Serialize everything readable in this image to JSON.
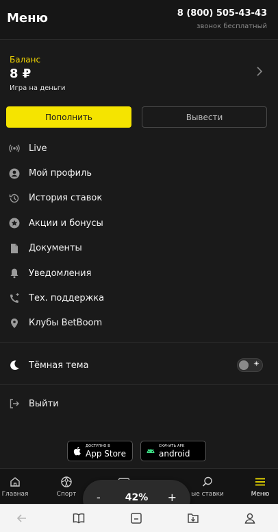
{
  "header": {
    "title": "Меню",
    "phone": "8 (800) 505-43-43",
    "phone_note": "звонок бесплатный"
  },
  "balance": {
    "label": "Баланс",
    "amount": "8 ₽",
    "subtitle": "Игра на деньги"
  },
  "actions": {
    "deposit": "Пополнить",
    "withdraw": "Вывести"
  },
  "menu": [
    {
      "label": "Live",
      "icon": "broadcast-icon"
    },
    {
      "label": "Мой профиль",
      "icon": "user-circle-icon"
    },
    {
      "label": "История ставок",
      "icon": "history-icon"
    },
    {
      "label": "Акции и бонусы",
      "icon": "star-circle-icon"
    },
    {
      "label": "Документы",
      "icon": "document-icon"
    },
    {
      "label": "Уведомления",
      "icon": "bell-icon"
    },
    {
      "label": "Тех. поддержка",
      "icon": "phone-forward-icon"
    },
    {
      "label": "Клубы BetBoom",
      "icon": "location-pin-icon"
    }
  ],
  "theme": {
    "label": "Тёмная тема",
    "enabled": true
  },
  "logout": {
    "label": "Выйти"
  },
  "stores": {
    "apple_small": "ДОСТУПНО В",
    "apple_big": "App Store",
    "android_small": "СКАЧАТЬ APK",
    "android_big": "android"
  },
  "bottom_nav": [
    {
      "label": "Главная",
      "icon": "home-icon"
    },
    {
      "label": "Спорт",
      "icon": "ball-icon"
    },
    {
      "label": "",
      "icon": "ticket-icon"
    },
    {
      "label": "ые ставки",
      "icon": "search-icon"
    },
    {
      "label": "Меню",
      "icon": "menu-icon"
    }
  ],
  "zoom": {
    "minus": "-",
    "value": "42%",
    "plus": "+"
  },
  "colors": {
    "accent": "#f5e400",
    "background": "#1a1a1a"
  }
}
